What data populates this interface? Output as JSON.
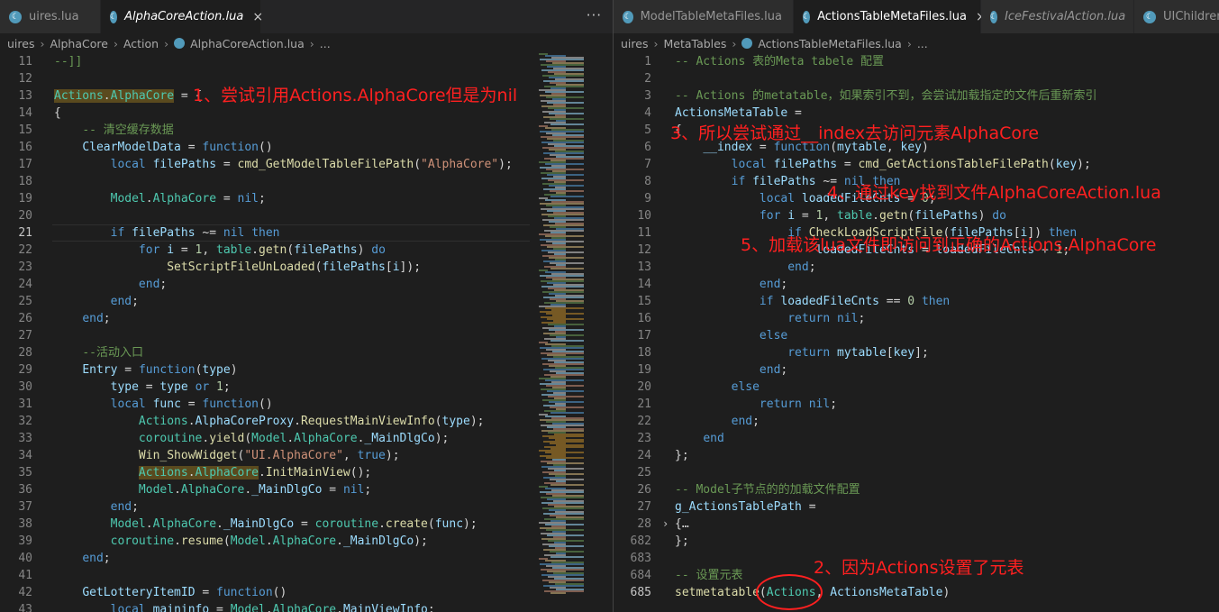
{
  "left": {
    "tabs": [
      {
        "label": "uires.lua",
        "active": false,
        "italic": false
      },
      {
        "label": "AlphaCoreAction.lua",
        "active": true,
        "italic": true
      }
    ],
    "more": "···",
    "breadcrumb": [
      "uires",
      "AlphaCore",
      "Action",
      "AlphaCoreAction.lua",
      "..."
    ],
    "lines": [
      {
        "n": "11",
        "t": "--]]"
      },
      {
        "n": "12",
        "t": ""
      },
      {
        "n": "13",
        "t": "Actions.AlphaCore = {"
      },
      {
        "n": "14",
        "t": "{"
      },
      {
        "n": "15",
        "t": "    -- 清空缓存数据"
      },
      {
        "n": "16",
        "t": "    ClearModelData = function()"
      },
      {
        "n": "17",
        "t": "        local filePaths = cmd_GetModelTableFilePath(\"AlphaCore\");"
      },
      {
        "n": "18",
        "t": ""
      },
      {
        "n": "19",
        "t": "        Model.AlphaCore = nil;"
      },
      {
        "n": "20",
        "t": ""
      },
      {
        "n": "21",
        "t": "        if filePaths ~= nil then"
      },
      {
        "n": "22",
        "t": "            for i = 1, table.getn(filePaths) do"
      },
      {
        "n": "23",
        "t": "                SetScriptFileUnLoaded(filePaths[i]);"
      },
      {
        "n": "24",
        "t": "            end;"
      },
      {
        "n": "25",
        "t": "        end;"
      },
      {
        "n": "26",
        "t": "    end;"
      },
      {
        "n": "27",
        "t": ""
      },
      {
        "n": "28",
        "t": "    --活动入口"
      },
      {
        "n": "29",
        "t": "    Entry = function(type)"
      },
      {
        "n": "30",
        "t": "        type = type or 1;"
      },
      {
        "n": "31",
        "t": "        local func = function()"
      },
      {
        "n": "32",
        "t": "            Actions.AlphaCoreProxy.RequestMainViewInfo(type);"
      },
      {
        "n": "33",
        "t": "            coroutine.yield(Model.AlphaCore._MainDlgCo);"
      },
      {
        "n": "34",
        "t": "            Win_ShowWidget(\"UI.AlphaCore\", true);"
      },
      {
        "n": "35",
        "t": "            Actions.AlphaCore.InitMainView();"
      },
      {
        "n": "36",
        "t": "            Model.AlphaCore._MainDlgCo = nil;"
      },
      {
        "n": "37",
        "t": "        end;"
      },
      {
        "n": "38",
        "t": "        Model.AlphaCore._MainDlgCo = coroutine.create(func);"
      },
      {
        "n": "39",
        "t": "        coroutine.resume(Model.AlphaCore._MainDlgCo);"
      },
      {
        "n": "40",
        "t": "    end;"
      },
      {
        "n": "41",
        "t": ""
      },
      {
        "n": "42",
        "t": "    GetLotteryItemID = function()"
      },
      {
        "n": "43",
        "t": "        local maininfo = Model.AlphaCore.MainViewInfo;"
      }
    ]
  },
  "right": {
    "tabs": [
      {
        "label": "ModelTableMetaFiles.lua",
        "active": false,
        "italic": false
      },
      {
        "label": "ActionsTableMetaFiles.lua",
        "active": true,
        "italic": false
      },
      {
        "label": "IceFestivalAction.lua",
        "active": false,
        "italic": true
      },
      {
        "label": "UIChildren",
        "active": false,
        "italic": false
      }
    ],
    "breadcrumb": [
      "uires",
      "MetaTables",
      "ActionsTableMetaFiles.lua",
      "..."
    ],
    "lines": [
      {
        "n": "1",
        "t": "-- Actions 表的Meta tabele 配置"
      },
      {
        "n": "2",
        "t": ""
      },
      {
        "n": "3",
        "t": "-- Actions 的metatable，如果索引不到，会尝试加载指定的文件后重新索引"
      },
      {
        "n": "4",
        "t": "ActionsMetaTable ="
      },
      {
        "n": "5",
        "t": "{"
      },
      {
        "n": "6",
        "t": "    __index = function(mytable, key)"
      },
      {
        "n": "7",
        "t": "        local filePaths = cmd_GetActionsTableFilePath(key);"
      },
      {
        "n": "8",
        "t": "        if filePaths ~= nil then"
      },
      {
        "n": "9",
        "t": "            local loadedFileCnts = 0;"
      },
      {
        "n": "10",
        "t": "            for i = 1, table.getn(filePaths) do"
      },
      {
        "n": "11",
        "t": "                if CheckLoadScriptFile(filePaths[i]) then"
      },
      {
        "n": "12",
        "t": "                    loadedFileCnts = loadedFileCnts + 1;"
      },
      {
        "n": "13",
        "t": "                end;"
      },
      {
        "n": "14",
        "t": "            end;"
      },
      {
        "n": "15",
        "t": "            if loadedFileCnts == 0 then"
      },
      {
        "n": "16",
        "t": "                return nil;"
      },
      {
        "n": "17",
        "t": "            else"
      },
      {
        "n": "18",
        "t": "                return mytable[key];"
      },
      {
        "n": "19",
        "t": "            end;"
      },
      {
        "n": "20",
        "t": "        else"
      },
      {
        "n": "21",
        "t": "            return nil;"
      },
      {
        "n": "22",
        "t": "        end;"
      },
      {
        "n": "23",
        "t": "    end"
      },
      {
        "n": "24",
        "t": "};"
      },
      {
        "n": "25",
        "t": ""
      },
      {
        "n": "26",
        "t": "-- Model子节点的的加载文件配置"
      },
      {
        "n": "27",
        "t": "g_ActionsTablePath ="
      },
      {
        "n": "28",
        "t": "{…"
      },
      {
        "n": "682",
        "t": "};"
      },
      {
        "n": "683",
        "t": ""
      },
      {
        "n": "684",
        "t": "-- 设置元表"
      },
      {
        "n": "685",
        "t": "setmetatable(Actions, ActionsMetaTable)"
      }
    ]
  },
  "annotations": {
    "a1": "1、尝试引用Actions.AlphaCore但是为nil",
    "a2": "2、因为Actions设置了元表",
    "a3": "3、所以尝试通过__index去访问元素AlphaCore",
    "a4": "4、通过key找到文件AlphaCoreAction.lua",
    "a5": "5、加载该lua文件即访问到正确的Actions.AlphaCore"
  },
  "colors": {
    "annotation": "#ff2020",
    "keyword": "#569cd6",
    "function": "#dcdcaa",
    "string": "#ce9178",
    "comment": "#6a9955"
  }
}
